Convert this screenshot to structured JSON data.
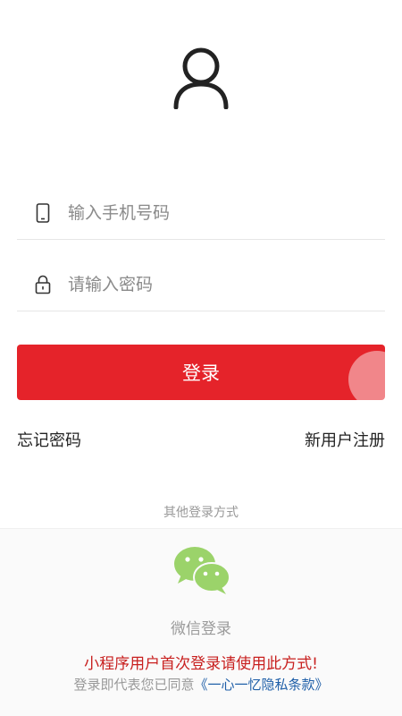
{
  "icons": {
    "avatar": "user-avatar-icon",
    "phone": "phone-icon",
    "lock": "lock-icon",
    "wechat": "wechat-icon"
  },
  "form": {
    "phone_placeholder": "输入手机号码",
    "password_placeholder": "请输入密码"
  },
  "login_button": "登录",
  "links": {
    "forgot_password": "忘记密码",
    "register": "新用户注册"
  },
  "other_login": {
    "title": "其他登录方式",
    "wechat_label": "微信登录",
    "notice": "小程序用户首次登录请使用此方式!",
    "agreement_prefix": "登录即代表您已同意",
    "policy_link": "《一心一忆隐私条款》"
  },
  "colors": {
    "primary": "#e5232a",
    "notice": "#c8201f",
    "link": "#1f5fa8",
    "wechat_green": "#9bd36a"
  }
}
